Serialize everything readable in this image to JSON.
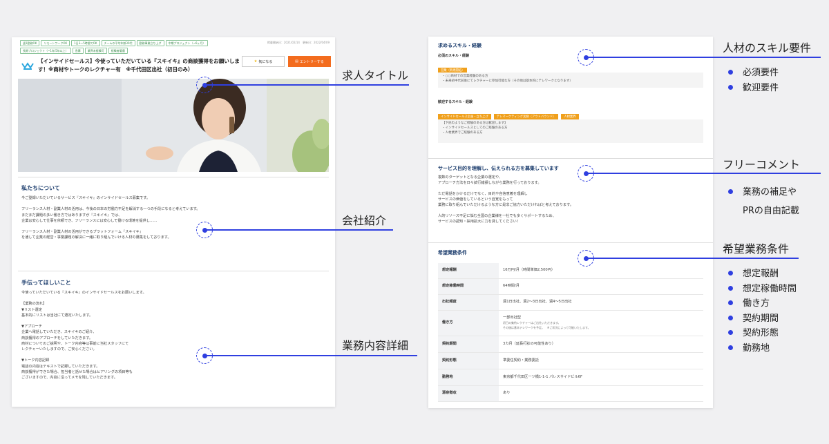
{
  "left": {
    "tags": [
      "週1勤務OK",
      "リモートワークOK",
      "1日3〜5時間でOK",
      "チームの平均年齢30代",
      "勤務事業立ち上げ",
      "中期プロジェクト（~6ヶ月）",
      "長期プロジェクト（~1年/5年以上）",
      "急募",
      "業界未経験可",
      "経験者優遇"
    ],
    "dates": "掲載開始日：2021/02/14　更新日：2022/04/09",
    "title": "【インサイドセールス】今使っていただいている『スキイキ』の商談獲得をお願いします！※商材やトークのレクチャー有　※千代田区出社（初日のみ）",
    "fav_label": "気になる",
    "entry_label": "エントリーする",
    "about_heading": "私たちについて",
    "about_body": "今ご登録いただいているサービス『スキイキ』のインサイドセールス募集です。\n\nフリーランス人材・副業人材の活用は、今後の日本の労働力不足を解消する一つの手段になると考えています。\nまだまだ課題の多い働き方ではありますが『スキイキ』では、\n企業は安心して仕事を依頼でき、フリーランスには安心して働ける環境を提供し……\n\nフリーランス人材・副業人材の活用ができるプラットフォーム『スキイキ』\nを通して企業の経営・事業課題の解決に一緒に取り組んでいける人材の募集をしております。",
    "task_heading": "手伝ってほしいこと",
    "task_body": "今使っていただいている『スキイキ』のインサイドセールスをお願いします。\n\n【業務の流れ】\n▼リスト選定\n基本的にリストは当社にて選定いたします。\n\n▼アプローチ\n企業へ電話していただき、スキイキのご紹介、\n商談獲得のアプローチをしていただきます。\n商材についてのご説明や、トーク内容等は事前に当社スタッフにて\nレクチャーいたしますので、ご安心ください。\n\n▼トーク内容記録\n電話の内容はテキストで記録していただきます。\n商談獲得ができた場合、担当者と話せた場合はヒアリングの項目等も\nございますので、内容に沿ってメモを残していただきます。"
  },
  "right": {
    "skill_heading": "求めるスキル・経験",
    "required_label": "必須のスキル・経験",
    "required_tags": [
      "営業（新規開拓）"
    ],
    "required_text": "・○○商材での営業経験のある方\n・未来初中代前後にてレクチャーに参加可能な方（その他は基本的にテレワークとなります）",
    "welcome_label": "歓迎するスキル・経験",
    "welcome_tags": [
      "インサイドセールス企画・立ち上げ",
      "テレマーケティング実務（アウトバウンド）",
      "人材業界"
    ],
    "welcome_text": "【下記のようなご経験のある方は歓迎します】\n・インサイドセールスとしてのご経験のある方\n・人材業界でご経験のある方",
    "purpose_heading": "サービス目的を理解し、伝えられる方を募集しています",
    "purpose_body": "複数のターゲットとなる企業の選定や、\nアプローチ方法を日々試行錯誤しながら業務を行っております。\n\nただ電話をかけるだけでなく、目的や自信意義を理解し\nサービスの価値をしているという自覚をもって\n業務に取り組んでいただけるような方に是非ご協力いただければと考えております。\n\n人的リソース不足に悩む全国の企業様を一社でも多くサポートするため、\nサービスの認知・採用拡大に力を貸してください！",
    "cond_heading": "希望業務条件",
    "conditions": [
      {
        "label": "想定報酬",
        "value": "16万円/月（時間単価2,500円）",
        "note": ""
      },
      {
        "label": "想定稼働時間",
        "value": "64時間/月",
        "note": ""
      },
      {
        "label": "出社頻度",
        "value": "週1日出社、週2〜3日出社、週4〜5日出社",
        "note": ""
      },
      {
        "label": "働き方",
        "value": "一部出社型",
        "note": "初日の集約レクチャーはご出社いただきます。\nその後は基本テレワークを予定。　※ご状況によって可能いたします。"
      },
      {
        "label": "契約期間",
        "value": "3カ月（延長打診の可能性あり）",
        "note": ""
      },
      {
        "label": "契約形態",
        "value": "準委任契約・業務委託",
        "note": ""
      },
      {
        "label": "勤務地",
        "value": "東京都千代田区一ツ橋1-1-1 パレスサイドビル6F",
        "note": ""
      },
      {
        "label": "源泉徴収",
        "value": "あり",
        "note": ""
      }
    ]
  },
  "annotations": {
    "job_title": "求人タイトル",
    "company_intro": "会社紹介",
    "task_detail": "業務内容詳細",
    "skill_req": "人材のスキル要件",
    "skill_items": [
      "必須要件",
      "歓迎要件"
    ],
    "free_comment": "フリーコメント",
    "free_items": [
      "業務の補足や",
      "PRの自由記載"
    ],
    "cond": "希望業務条件",
    "cond_items": [
      "想定報酬",
      "想定稼働時間",
      "働き方",
      "契約期間",
      "契約形態",
      "勤務地"
    ]
  },
  "colors": {
    "accent": "#2f3fe0",
    "orange": "#f36c1e",
    "tag_orange": "#f0a01c",
    "heading": "#1c3d6d"
  }
}
